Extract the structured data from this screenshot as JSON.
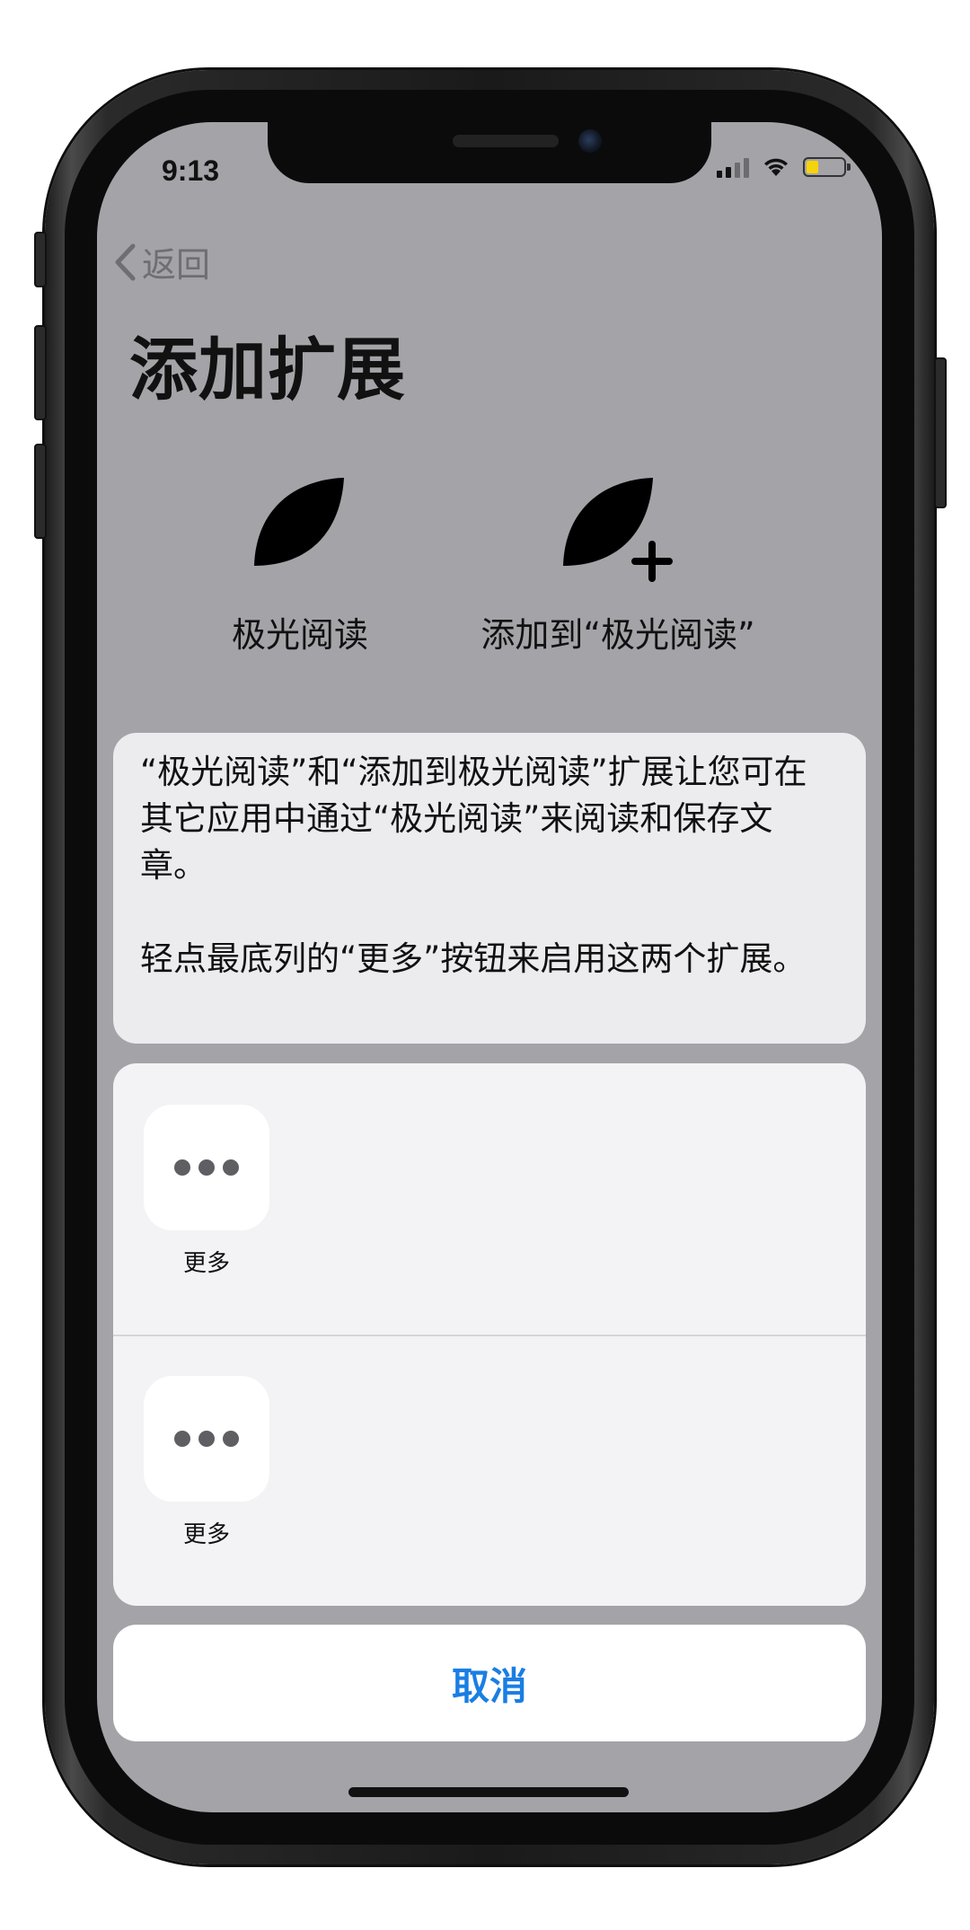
{
  "status_bar": {
    "time": "9:13",
    "battery_level": 0.3,
    "signal_bars_active": 2
  },
  "nav": {
    "back_label": "返回"
  },
  "title": "添加扩展",
  "extensions": [
    {
      "label": "极光阅读",
      "icon": "leaf-icon"
    },
    {
      "label": "添加到“极光阅读”",
      "icon": "leaf-plus-icon"
    }
  ],
  "description": {
    "paragraph1": "“极光阅读”和“添加到极光阅读”扩展让您可在其它应用中通过“极光阅读”来阅读和保存文章。",
    "paragraph2": "轻点最底列的“更多”按钮来启用这两个扩展。"
  },
  "action_rows": [
    {
      "label": "更多",
      "icon": "more-dots-icon"
    },
    {
      "label": "更多",
      "icon": "more-dots-icon"
    }
  ],
  "cancel_label": "取消",
  "colors": {
    "screen_background": "#a4a3a8",
    "accent": "#1a7ee3",
    "battery_fill": "#f5d40c"
  }
}
